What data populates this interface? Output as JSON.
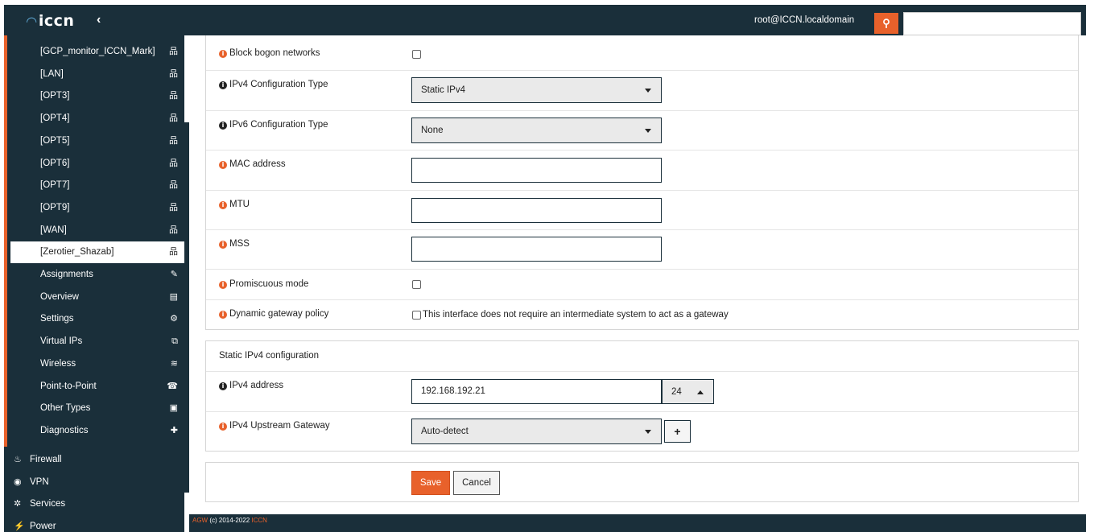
{
  "header": {
    "logo": "iccn",
    "collapse_icon": "chevron-left-icon",
    "user": "root@ICCN.localdomain",
    "search_icon": "search-icon",
    "search_value": ""
  },
  "sidebar": {
    "interfaces": [
      {
        "label": "[GCP_monitor_ICCN_Mark]",
        "icon": "network-icon"
      },
      {
        "label": "[LAN]",
        "icon": "network-icon"
      },
      {
        "label": "[OPT3]",
        "icon": "network-icon"
      },
      {
        "label": "[OPT4]",
        "icon": "network-icon"
      },
      {
        "label": "[OPT5]",
        "icon": "network-icon"
      },
      {
        "label": "[OPT6]",
        "icon": "network-icon"
      },
      {
        "label": "[OPT7]",
        "icon": "network-icon"
      },
      {
        "label": "[OPT9]",
        "icon": "network-icon"
      },
      {
        "label": "[WAN]",
        "icon": "network-icon"
      },
      {
        "label": "[Zerotier_Shazab]",
        "icon": "network-icon",
        "active": true
      },
      {
        "label": "Assignments",
        "icon": "pencil-icon"
      },
      {
        "label": "Overview",
        "icon": "list-icon"
      },
      {
        "label": "Settings",
        "icon": "gears-icon"
      },
      {
        "label": "Virtual IPs",
        "icon": "copy-icon"
      },
      {
        "label": "Wireless",
        "icon": "wifi-icon"
      },
      {
        "label": "Point-to-Point",
        "icon": "phone-icon"
      },
      {
        "label": "Other Types",
        "icon": "archive-icon"
      },
      {
        "label": "Diagnostics",
        "icon": "medkit-icon"
      }
    ],
    "top_items": [
      {
        "label": "Firewall",
        "icon": "fire-icon"
      },
      {
        "label": "VPN",
        "icon": "globe-icon"
      },
      {
        "label": "Services",
        "icon": "cog-icon"
      },
      {
        "label": "Power",
        "icon": "plug-icon"
      }
    ]
  },
  "general": {
    "block_bogon": {
      "label": "Block bogon networks",
      "checked": false
    },
    "ipv4_type": {
      "label": "IPv4 Configuration Type",
      "value": "Static IPv4"
    },
    "ipv6_type": {
      "label": "IPv6 Configuration Type",
      "value": "None"
    },
    "mac": {
      "label": "MAC address",
      "value": ""
    },
    "mtu": {
      "label": "MTU",
      "value": ""
    },
    "mss": {
      "label": "MSS",
      "value": ""
    },
    "promiscuous": {
      "label": "Promiscuous mode",
      "checked": false
    },
    "dyn_gateway": {
      "label": "Dynamic gateway policy",
      "checkbox_text": "This interface does not require an intermediate system to act as a gateway",
      "checked": false
    }
  },
  "static_ipv4": {
    "title": "Static IPv4 configuration",
    "address": {
      "label": "IPv4 address",
      "value": "192.168.192.21",
      "prefix": "24"
    },
    "gateway": {
      "label": "IPv4 Upstream Gateway",
      "value": "Auto-detect",
      "add_label": "+"
    }
  },
  "actions": {
    "save": "Save",
    "cancel": "Cancel"
  },
  "footer": {
    "brand": "AGW",
    "copyright": "(c) 2014-2022",
    "company": "ICCN"
  },
  "colors": {
    "accent": "#e8612b",
    "navy": "#1a2f3a"
  }
}
